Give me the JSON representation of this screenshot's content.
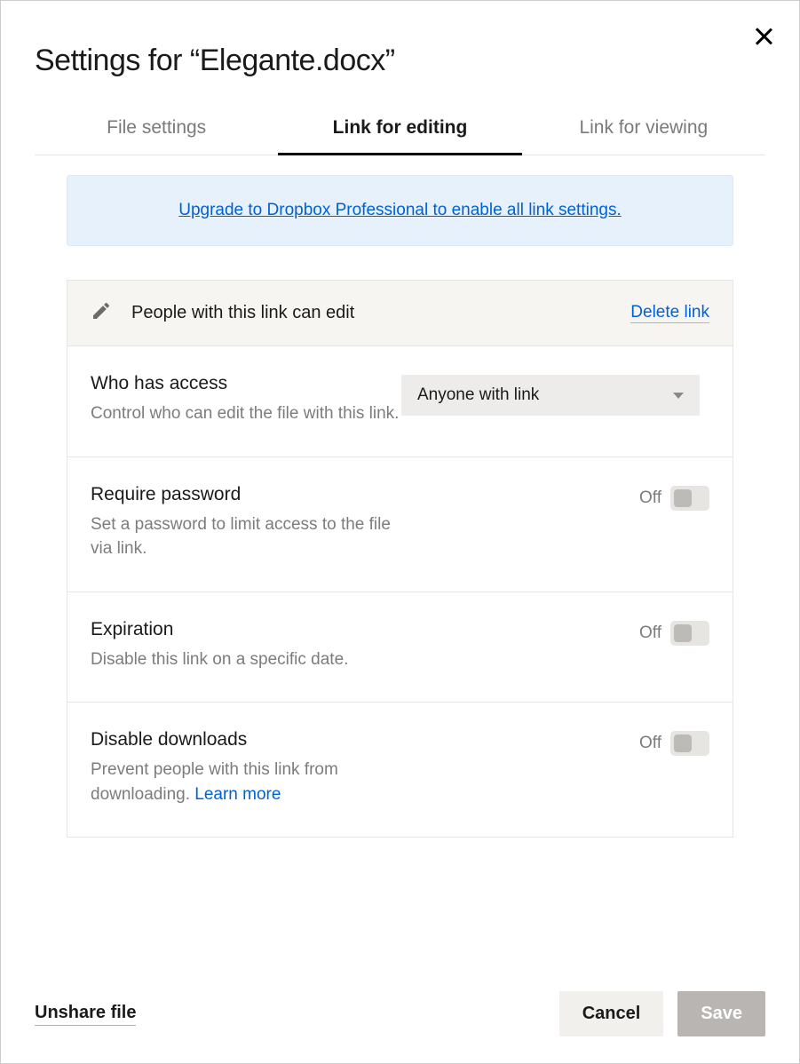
{
  "title": "Settings for “Elegante.docx”",
  "tabs": [
    {
      "label": "File settings",
      "active": false
    },
    {
      "label": "Link for editing",
      "active": true
    },
    {
      "label": "Link for viewing",
      "active": false
    }
  ],
  "banner": {
    "link_text": "Upgrade to Dropbox Professional to enable all link settings."
  },
  "panel": {
    "header_label": "People with this link can edit",
    "delete_label": "Delete link"
  },
  "settings": {
    "access": {
      "title": "Who has access",
      "desc": "Control who can edit the file with this link.",
      "value": "Anyone with link"
    },
    "password": {
      "title": "Require password",
      "desc": "Set a password to limit access to the file via link.",
      "state": "Off"
    },
    "expiration": {
      "title": "Expiration",
      "desc": "Disable this link on a specific date.",
      "state": "Off"
    },
    "downloads": {
      "title": "Disable downloads",
      "desc_prefix": "Prevent people with this link from downloading. ",
      "learn_more": "Learn more",
      "state": "Off"
    }
  },
  "footer": {
    "unshare": "Unshare file",
    "cancel": "Cancel",
    "save": "Save"
  }
}
